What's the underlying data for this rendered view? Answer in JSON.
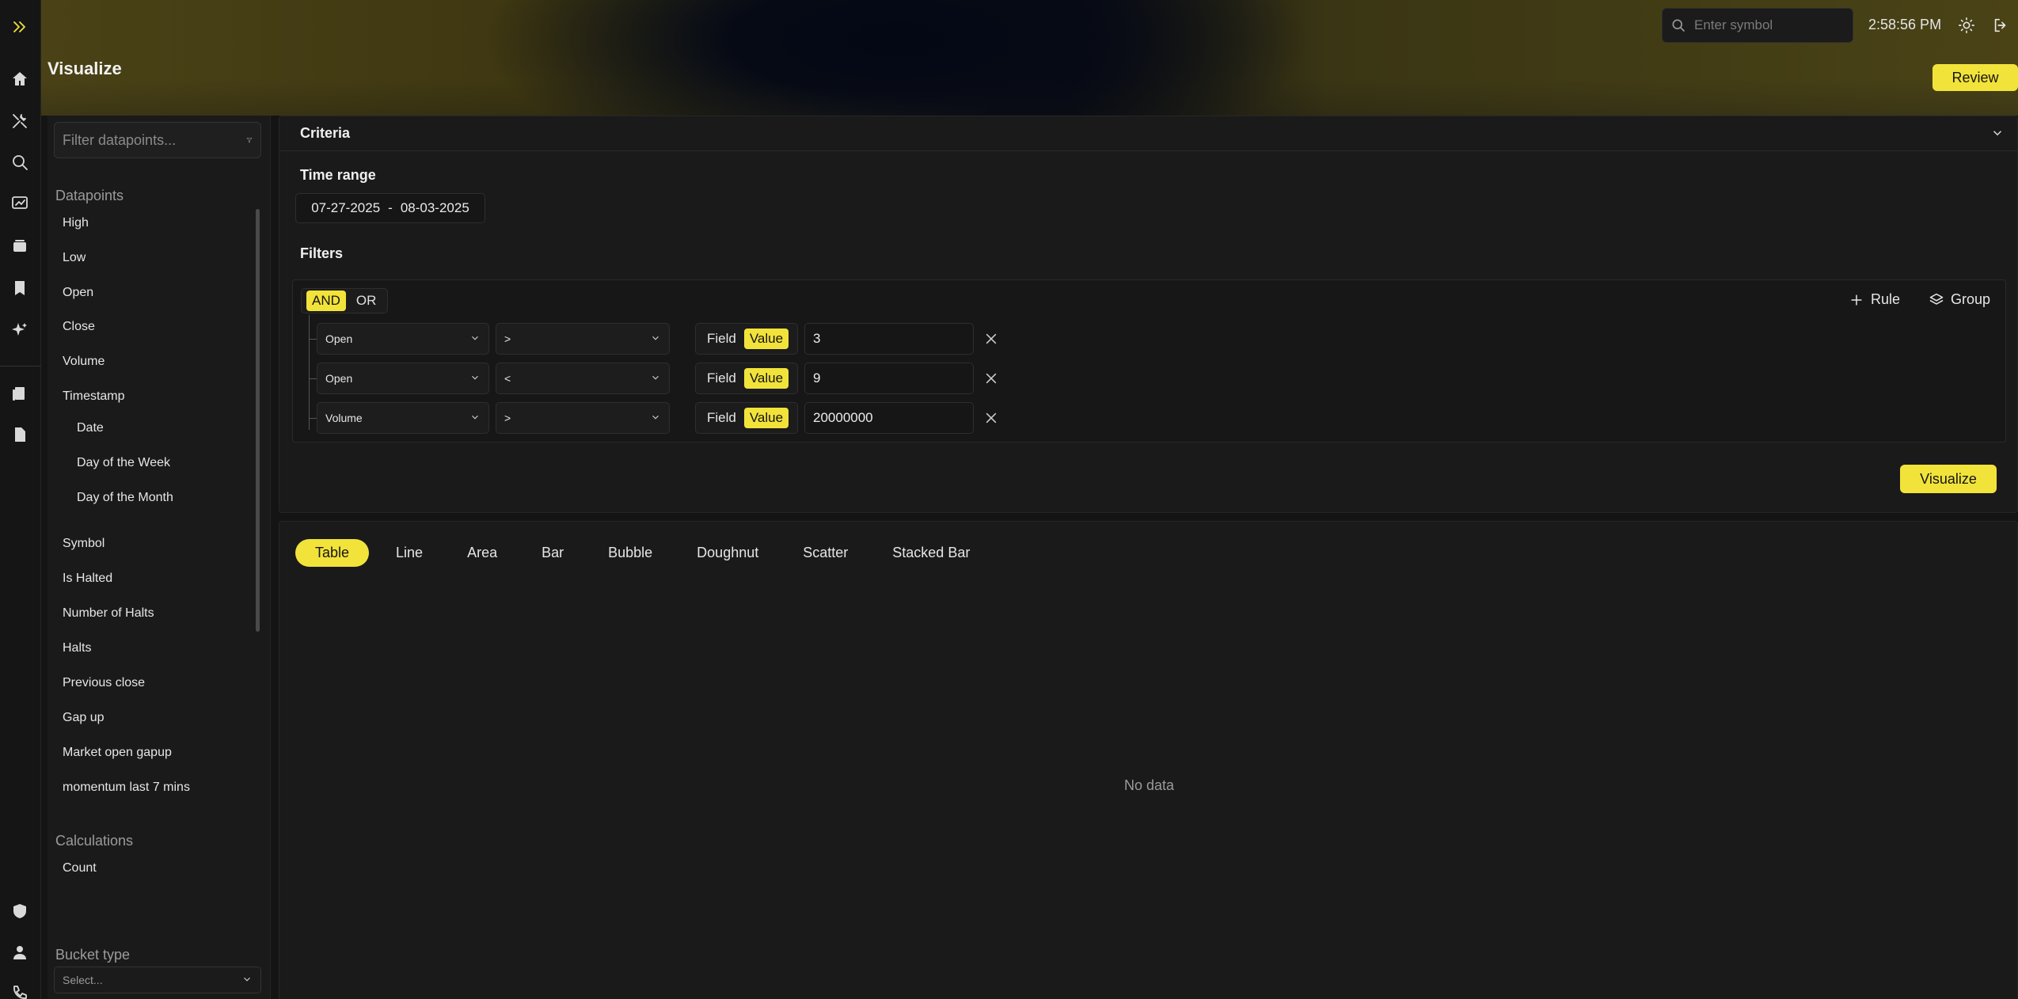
{
  "header": {
    "page_title": "Visualize",
    "search_placeholder": "Enter symbol",
    "clock": "2:58:56 PM",
    "review_label": "Review"
  },
  "sidebar": {
    "filter_placeholder": "Filter datapoints...",
    "datapoints_label": "Datapoints",
    "datapoints": [
      "High",
      "Low",
      "Open",
      "Close",
      "Volume",
      "Timestamp"
    ],
    "timestamp_children": [
      "Date",
      "Day of the Week",
      "Day of the Month"
    ],
    "more_datapoints": [
      "Symbol",
      "Is Halted",
      "Number of Halts",
      "Halts",
      "Previous close",
      "Gap up",
      "Market open gapup",
      "momentum last 7 mins"
    ],
    "calculations_label": "Calculations",
    "calculations": [
      "Count"
    ],
    "bucket_label": "Bucket type",
    "bucket_placeholder": "Select..."
  },
  "criteria": {
    "title": "Criteria",
    "time_range_label": "Time range",
    "date_start": "07-27-2025",
    "date_sep": "-",
    "date_end": "08-03-2025",
    "filters_label": "Filters",
    "and_label": "AND",
    "or_label": "OR",
    "add_rule_label": "Rule",
    "add_group_label": "Group",
    "field_label": "Field",
    "value_label": "Value",
    "rules": [
      {
        "field": "Open",
        "op": ">",
        "value": "3"
      },
      {
        "field": "Open",
        "op": "<",
        "value": "9"
      },
      {
        "field": "Volume",
        "op": ">",
        "value": "20000000"
      }
    ],
    "visualize_label": "Visualize"
  },
  "results": {
    "tabs": [
      "Table",
      "Line",
      "Area",
      "Bar",
      "Bubble",
      "Doughnut",
      "Scatter",
      "Stacked Bar"
    ],
    "active_tab": "Table",
    "empty_text": "No data"
  },
  "colors": {
    "accent": "#f2e33a",
    "background": "#141414",
    "panel": "#1a1a1a"
  }
}
